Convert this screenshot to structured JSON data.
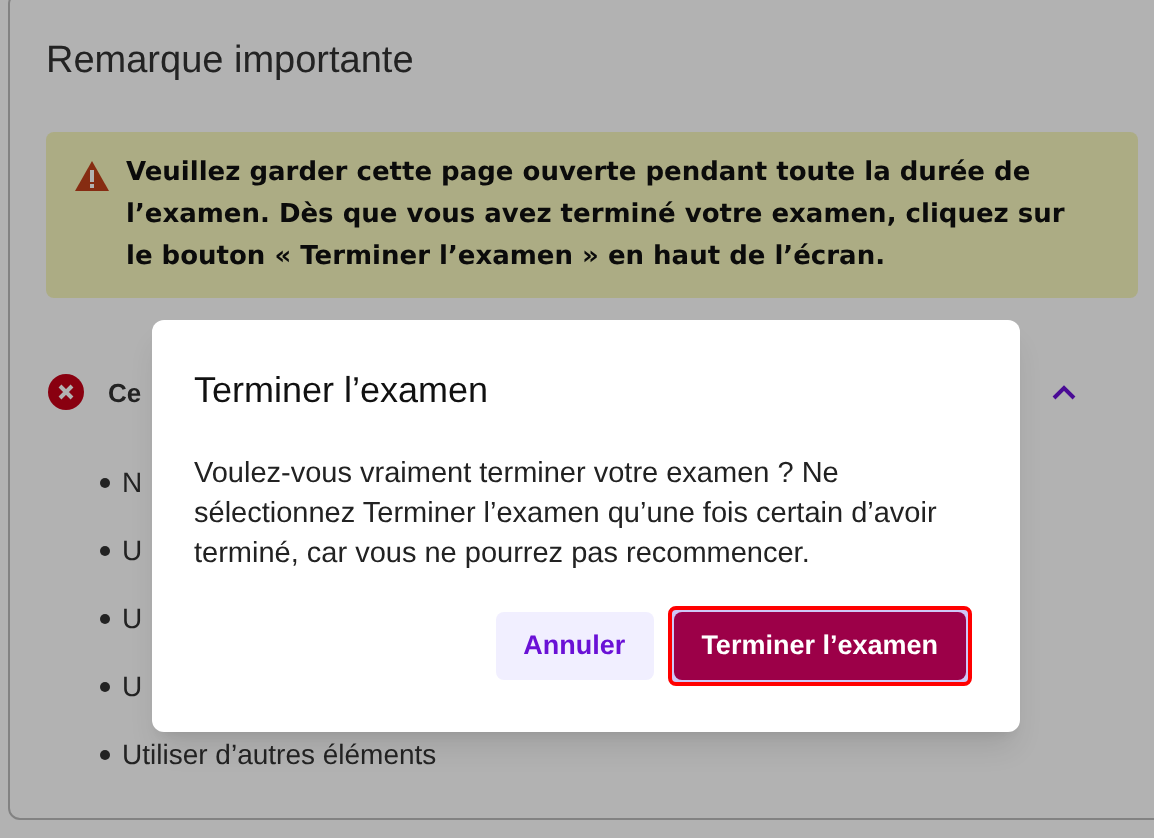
{
  "page": {
    "title": "Remarque importante",
    "notice": "Veuillez garder cette page ouverte pendant toute la durée de l’examen. Dès que vous avez terminé votre examen, cliquez sur le bouton « Terminer l’examen » en haut de l’écran.",
    "section": {
      "title": "Ce",
      "expanded": true,
      "items": [
        "N",
        "U",
        "U",
        "U",
        "Utiliser d’autres éléments"
      ]
    }
  },
  "dialog": {
    "title": "Terminer l’examen",
    "message": "Voulez-vous vraiment terminer votre examen ? Ne sélectionnez Terminer l’examen qu’une fois certain d’avoir terminé, car vous ne pourrez pas recommencer.",
    "buttons": [
      {
        "label": "Annuler",
        "kind": "secondary",
        "focused": false
      },
      {
        "label": "Terminer l’examen",
        "kind": "primary",
        "focused": true
      }
    ]
  }
}
